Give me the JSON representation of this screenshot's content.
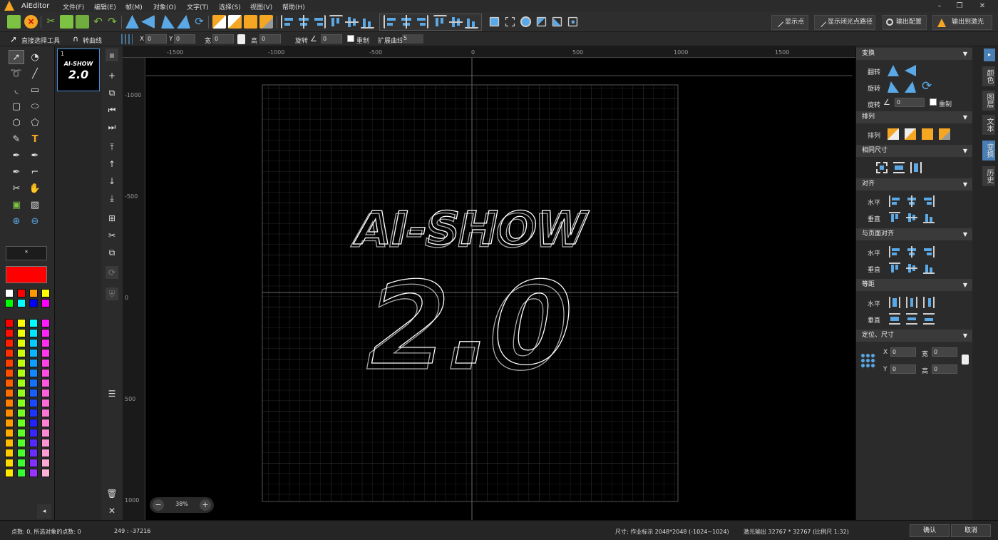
{
  "app": {
    "title": "AiEditor"
  },
  "menus": [
    "文件(F)",
    "编辑(E)",
    "帧(M)",
    "对象(O)",
    "文字(T)",
    "选择(S)",
    "视图(V)",
    "帮助(H)"
  ],
  "right_buttons": {
    "show_points": "显示点",
    "show_path": "显示闭光点路径",
    "output_config": "输出配置",
    "output_laser": "输出到激光"
  },
  "props": {
    "tool_name": "直接选择工具",
    "convert": "转曲线",
    "x_label": "X",
    "x": "0",
    "y_label": "Y",
    "y": "0",
    "w_label": "宽",
    "w": "0",
    "h_label": "高",
    "h": "0",
    "rotate_label": "旋转",
    "rotate": "0",
    "copy_label": "重制",
    "expand_label": "扩展曲线",
    "expand": "5"
  },
  "color_swatch_label": "*",
  "colors": {
    "current": "#ff0000",
    "accent": "#4a7fb5",
    "warning": "#f5a623"
  },
  "frame": {
    "number": "1",
    "thumb_line1": "AI-SHOW",
    "thumb_line2": "2.0"
  },
  "ruler": {
    "h": [
      "-1500",
      "-1000",
      "-500",
      "0",
      "500",
      "1000",
      "1500"
    ],
    "v": [
      "-1000",
      "-500",
      "0",
      "500",
      "1000"
    ]
  },
  "canvas": {
    "line1": "AI-SHOW",
    "line2": "2.0"
  },
  "zoom": {
    "value": "38%"
  },
  "panel": {
    "transform": {
      "title": "变换",
      "flip": "翻转",
      "rotate": "旋转",
      "rotate2": "旋转",
      "angle": "0",
      "copy": "重制"
    },
    "arrange": {
      "title": "排列",
      "label": "排列"
    },
    "same_size": {
      "title": "相同尺寸"
    },
    "align": {
      "title": "对齐",
      "h": "水平",
      "v": "垂直"
    },
    "page_align": {
      "title": "与页面对齐",
      "h": "水平",
      "v": "垂直"
    },
    "distribute": {
      "title": "等距",
      "h": "水平",
      "v": "垂直"
    },
    "position": {
      "title": "定位、尺寸",
      "x_label": "X",
      "x": "0",
      "w_label": "宽",
      "w": "0",
      "y_label": "Y",
      "y": "0",
      "h_label": "高",
      "h": "0"
    }
  },
  "tabs": [
    "颜色",
    "图层",
    "文本",
    "变换",
    "历史"
  ],
  "status": {
    "points": "点数: 0, 所选对象的点数: 0",
    "coords": "249 : -37216",
    "size": "尺寸: 作业标示 2048*2048 (-1024~1024)",
    "laser": "激光输出 32767 * 32767 (比例尺 1:32)",
    "ok": "确认",
    "cancel": "取消"
  }
}
